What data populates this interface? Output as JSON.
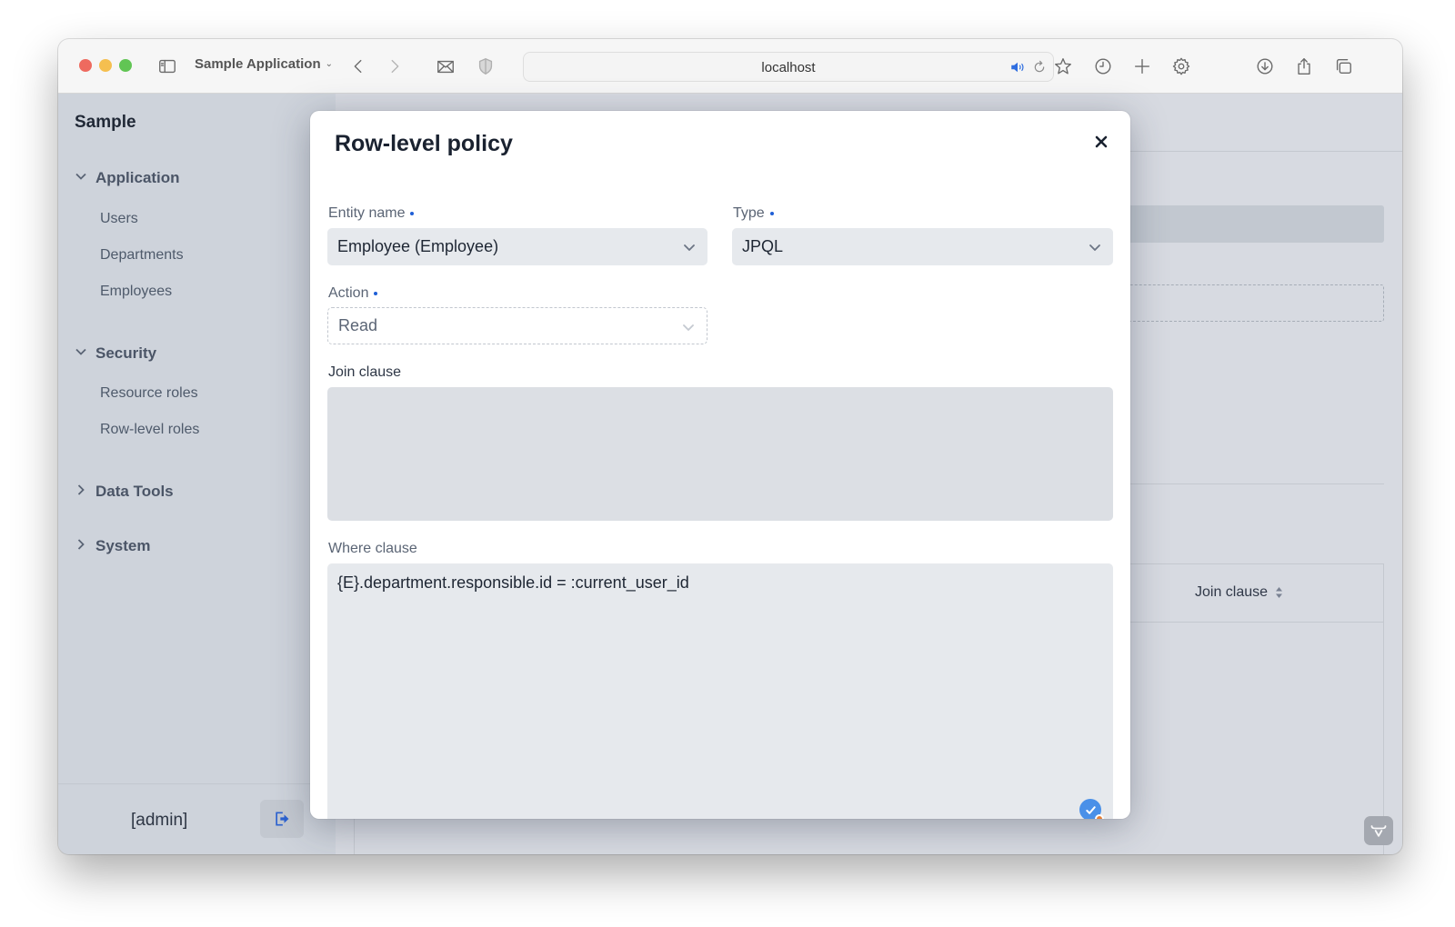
{
  "browser": {
    "app_title": "Sample Application",
    "url": "localhost",
    "icons": [
      "sidebar-toggle-icon",
      "back-icon",
      "forward-icon",
      "mail-icon",
      "shield-icon",
      "speaker-icon",
      "reload-icon",
      "star-icon",
      "history-icon",
      "new-tab-icon",
      "settings-icon",
      "download-icon",
      "share-icon",
      "tabs-icon"
    ]
  },
  "sidebar": {
    "brand": "Sample",
    "groups": [
      {
        "label": "Application",
        "expanded": true,
        "items": [
          "Users",
          "Departments",
          "Employees"
        ]
      },
      {
        "label": "Security",
        "expanded": true,
        "items": [
          "Resource roles",
          "Row-level roles"
        ]
      },
      {
        "label": "Data Tools",
        "expanded": false,
        "items": []
      },
      {
        "label": "System",
        "expanded": false,
        "items": []
      }
    ],
    "user": "[admin]"
  },
  "background": {
    "table_header_join_clause": "Join clause"
  },
  "dialog": {
    "title": "Row-level policy",
    "fields": {
      "entity_name": {
        "label": "Entity name",
        "required": true,
        "value": "Employee (Employee)"
      },
      "type": {
        "label": "Type",
        "required": true,
        "value": "JPQL"
      },
      "action": {
        "label": "Action",
        "required": true,
        "value": "Read",
        "readonly": true
      },
      "join_clause": {
        "label": "Join clause",
        "value": ""
      },
      "where_clause": {
        "label": "Where clause",
        "value": "{E}.department.responsible.id = :current_user_id"
      }
    }
  },
  "colors": {
    "accent": "#1f5fd6",
    "sidebar_bg": "#d3d8df",
    "field_bg": "#e6e9ed"
  }
}
